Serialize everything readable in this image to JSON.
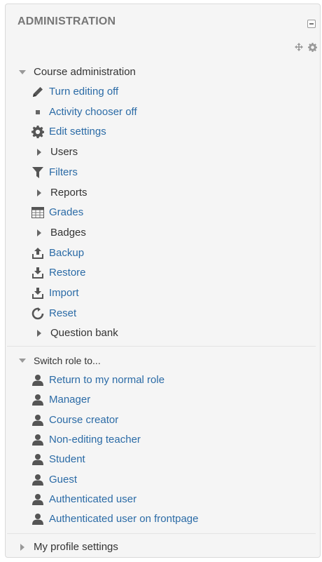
{
  "block": {
    "title": "ADMINISTRATION",
    "accent_link": "#2b6ba6",
    "icons": [
      "collapse-icon",
      "move-icon",
      "gear-icon"
    ]
  },
  "course_admin": {
    "label": "Course administration",
    "items": [
      {
        "label": "Turn editing off",
        "icon": "pencil-icon",
        "type": "link"
      },
      {
        "label": "Activity chooser off",
        "icon": "square-bullet-icon",
        "type": "link"
      },
      {
        "label": "Edit settings",
        "icon": "gear-icon",
        "type": "link"
      },
      {
        "label": "Users",
        "icon": "caret-right-icon",
        "type": "branch"
      },
      {
        "label": "Filters",
        "icon": "filter-icon",
        "type": "link"
      },
      {
        "label": "Reports",
        "icon": "caret-right-icon",
        "type": "branch"
      },
      {
        "label": "Grades",
        "icon": "table-icon",
        "type": "link"
      },
      {
        "label": "Badges",
        "icon": "caret-right-icon",
        "type": "branch"
      },
      {
        "label": "Backup",
        "icon": "upload-icon",
        "type": "link"
      },
      {
        "label": "Restore",
        "icon": "download-icon",
        "type": "link"
      },
      {
        "label": "Import",
        "icon": "download-icon",
        "type": "link"
      },
      {
        "label": "Reset",
        "icon": "refresh-icon",
        "type": "link"
      },
      {
        "label": "Question bank",
        "icon": "caret-right-icon",
        "type": "branch"
      }
    ]
  },
  "switch_role": {
    "label": "Switch role to...",
    "items": [
      {
        "label": "Return to my normal role",
        "icon": "user-icon"
      },
      {
        "label": "Manager",
        "icon": "user-icon"
      },
      {
        "label": "Course creator",
        "icon": "user-icon"
      },
      {
        "label": "Non-editing teacher",
        "icon": "user-icon"
      },
      {
        "label": "Student",
        "icon": "user-icon"
      },
      {
        "label": "Guest",
        "icon": "user-icon"
      },
      {
        "label": "Authenticated user",
        "icon": "user-icon"
      },
      {
        "label": "Authenticated user on frontpage",
        "icon": "user-icon"
      }
    ]
  },
  "profile": {
    "label": "My profile settings"
  }
}
